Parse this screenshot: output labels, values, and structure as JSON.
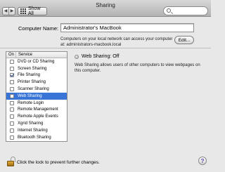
{
  "window": {
    "title": "Sharing"
  },
  "toolbar": {
    "back_glyph": "◀",
    "forward_glyph": "▶",
    "show_all_label": "Show All",
    "search": {
      "value": "",
      "placeholder": ""
    }
  },
  "computer_name": {
    "label": "Computer Name:",
    "value": "Administrator's MacBook",
    "description": "Computers on your local network can access your computer at: administrators-macbook.local",
    "edit_label": "Edit..."
  },
  "services": {
    "header_on": "On",
    "header_service": "Service",
    "items": [
      {
        "label": "DVD or CD Sharing",
        "checked": false,
        "selected": false
      },
      {
        "label": "Screen Sharing",
        "checked": false,
        "selected": false
      },
      {
        "label": "File Sharing",
        "checked": true,
        "selected": false
      },
      {
        "label": "Printer Sharing",
        "checked": false,
        "selected": false
      },
      {
        "label": "Scanner Sharing",
        "checked": false,
        "selected": false
      },
      {
        "label": "Web Sharing",
        "checked": false,
        "selected": true
      },
      {
        "label": "Remote Login",
        "checked": false,
        "selected": false
      },
      {
        "label": "Remote Management",
        "checked": false,
        "selected": false
      },
      {
        "label": "Remote Apple Events",
        "checked": false,
        "selected": false
      },
      {
        "label": "Xgrid Sharing",
        "checked": false,
        "selected": false
      },
      {
        "label": "Internet Sharing",
        "checked": false,
        "selected": false
      },
      {
        "label": "Bluetooth Sharing",
        "checked": false,
        "selected": false
      }
    ]
  },
  "detail": {
    "status": "Web Sharing: Off",
    "description": "Web Sharing allows users of other computers to view webpages on this computer."
  },
  "footer": {
    "lock_text": "Click the lock to prevent further changes.",
    "help_glyph": "?"
  },
  "colors": {
    "selection": "#3875d7",
    "lock": "#d19a2a"
  }
}
